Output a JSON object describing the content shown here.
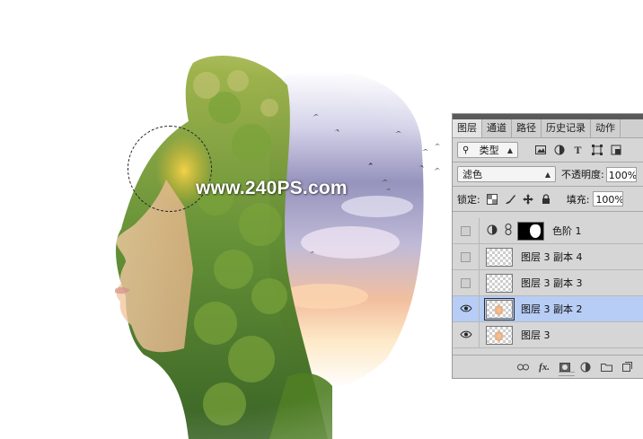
{
  "canvas": {
    "watermark": "www.240PS.com"
  },
  "panel": {
    "tabs": [
      "图层",
      "通道",
      "路径",
      "历史记录",
      "动作"
    ],
    "filter": {
      "label": "类型",
      "icons": [
        "image-filter-icon",
        "adjustment-filter-icon",
        "type-filter-icon",
        "shape-filter-icon",
        "smart-object-filter-icon"
      ]
    },
    "blend_mode": "滤色",
    "opacity_label": "不透明度:",
    "opacity_value": "100%",
    "lock_label": "锁定:",
    "fill_label": "填充:",
    "fill_value": "100%",
    "layers": [
      {
        "name": "色阶 1",
        "visible": false,
        "type": "adjustment"
      },
      {
        "name": "图层 3 副本 4",
        "visible": false,
        "type": "pixel"
      },
      {
        "name": "图层 3 副本 3",
        "visible": false,
        "type": "pixel"
      },
      {
        "name": "图层 3 副本 2",
        "visible": true,
        "type": "pixel",
        "selected": true
      },
      {
        "name": "图层 3",
        "visible": true,
        "type": "pixel"
      }
    ],
    "footer_icons": [
      "link-icon",
      "fx-icon",
      "mask-icon",
      "adjustment-icon",
      "group-folder-icon",
      "new-layer-icon"
    ],
    "footer_fx_label": "fx.",
    "colors": {
      "selected_row": "#b7cdf5",
      "panel_bg": "#d6d6d6"
    }
  }
}
